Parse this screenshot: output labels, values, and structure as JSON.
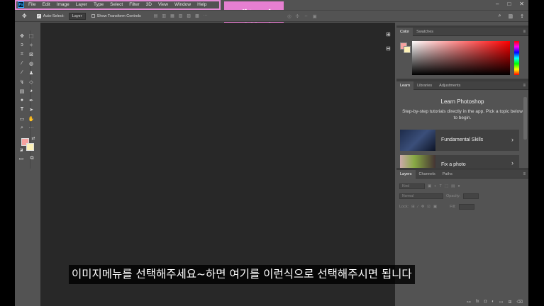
{
  "menubar": {
    "logo": "Ps",
    "items": [
      "File",
      "Edit",
      "Image",
      "Layer",
      "Type",
      "Select",
      "Filter",
      "3D",
      "View",
      "Window",
      "Help"
    ],
    "window_controls": [
      "–",
      "□",
      "✕"
    ]
  },
  "annotation": {
    "label": "메뉴바",
    "highlight_color": "#e67fd1"
  },
  "options_bar": {
    "auto_select_label": "Auto-Select:",
    "auto_select_checked": true,
    "auto_select_value": "Layer",
    "show_transform_label": "Show Transform Controls",
    "show_transform_checked": false
  },
  "toolbar": {
    "foreground_color": "#f6a3a0",
    "background_color": "#fdf2b8"
  },
  "panels": {
    "color": {
      "tabs": [
        "Color",
        "Swatches"
      ],
      "active_tab": "Color"
    },
    "learn": {
      "tabs": [
        "Learn",
        "Libraries",
        "Adjustments"
      ],
      "active_tab": "Learn",
      "title": "Learn Photoshop",
      "description": "Step-by-step tutorials directly in the app. Pick a topic below to begin.",
      "cards": [
        "Fundamental Skills",
        "Fix a photo"
      ]
    },
    "layers": {
      "tabs": [
        "Layers",
        "Channels",
        "Paths"
      ],
      "active_tab": "Layers",
      "filter_placeholder": "Kind",
      "blend_mode": "Normal",
      "opacity_label": "Opacity:",
      "lock_label": "Lock:",
      "fill_label": "Fill:"
    }
  },
  "subtitle": {
    "text": "이미지메뉴를 선택해주세요~하면 여기를 이런식으로 선택해주시면 됩니다"
  }
}
